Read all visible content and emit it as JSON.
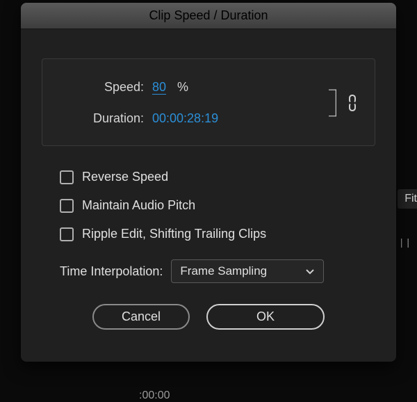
{
  "dialog": {
    "title": "Clip Speed / Duration"
  },
  "speed": {
    "label": "Speed:",
    "value": "80",
    "suffix": "%"
  },
  "duration": {
    "label": "Duration:",
    "value": "00:00:28:19"
  },
  "checkboxes": {
    "reverse": "Reverse Speed",
    "maintain": "Maintain Audio Pitch",
    "ripple": "Ripple Edit, Shifting Trailing Clips"
  },
  "interp": {
    "label": "Time Interpolation:",
    "selected": "Frame Sampling"
  },
  "buttons": {
    "cancel": "Cancel",
    "ok": "OK"
  },
  "background": {
    "fit": "Fit",
    "timecode": ":00:00",
    "ruler": "| | |"
  }
}
